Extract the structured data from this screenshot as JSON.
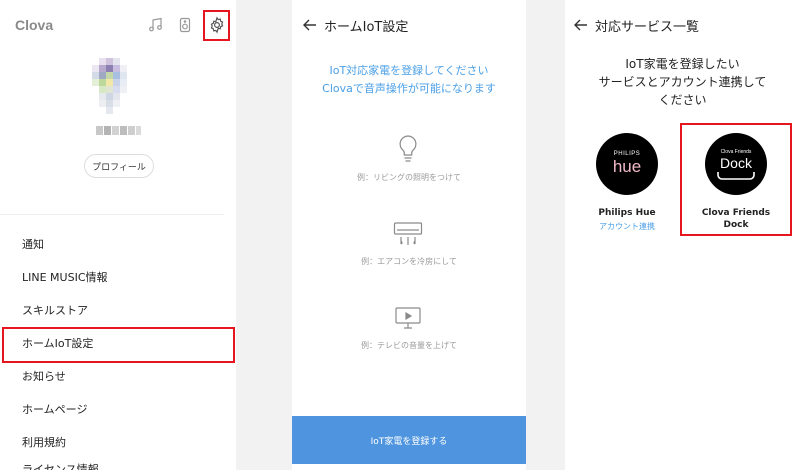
{
  "left_panel": {
    "brand": "Clova",
    "profile_button": "プロフィール",
    "menu": [
      {
        "label": "通知"
      },
      {
        "label": "LINE MUSIC情報"
      },
      {
        "label": "スキルストア"
      },
      {
        "label": "ホームIoT設定"
      },
      {
        "label": "お知らせ"
      },
      {
        "label": "ホームページ"
      },
      {
        "label": "利用規約"
      },
      {
        "label": "ライセンス情報"
      }
    ],
    "highlight_color": "#e5161f"
  },
  "home_iot": {
    "title": "ホームIoT設定",
    "headline_line1": "IoT対応家電を登録してください",
    "headline_line2": "Clovaで音声操作が可能になります",
    "examples": [
      {
        "icon": "lightbulb-icon",
        "text": "例：リビングの照明をつけて"
      },
      {
        "icon": "air-conditioner-icon",
        "text": "例：エアコンを冷房にして"
      },
      {
        "icon": "tv-icon",
        "text": "例：テレビの音量を上げて"
      }
    ],
    "register_button": "IoT家電を登録する",
    "accent_color": "#4a9fe6"
  },
  "services": {
    "title": "対応サービス一覧",
    "desc_line1": "IoT家電を登録したい",
    "desc_line2": "サービスとアカウント連携して",
    "desc_line3": "ください",
    "items": [
      {
        "name": "Philips Hue",
        "logo_top": "PHILIPS",
        "logo_main": "hue",
        "link": "アカウント連携"
      },
      {
        "name_line1": "Clova Friends",
        "name_line2": "Dock",
        "logo_top": "Clova Friends",
        "logo_main": "Dock"
      }
    ]
  }
}
